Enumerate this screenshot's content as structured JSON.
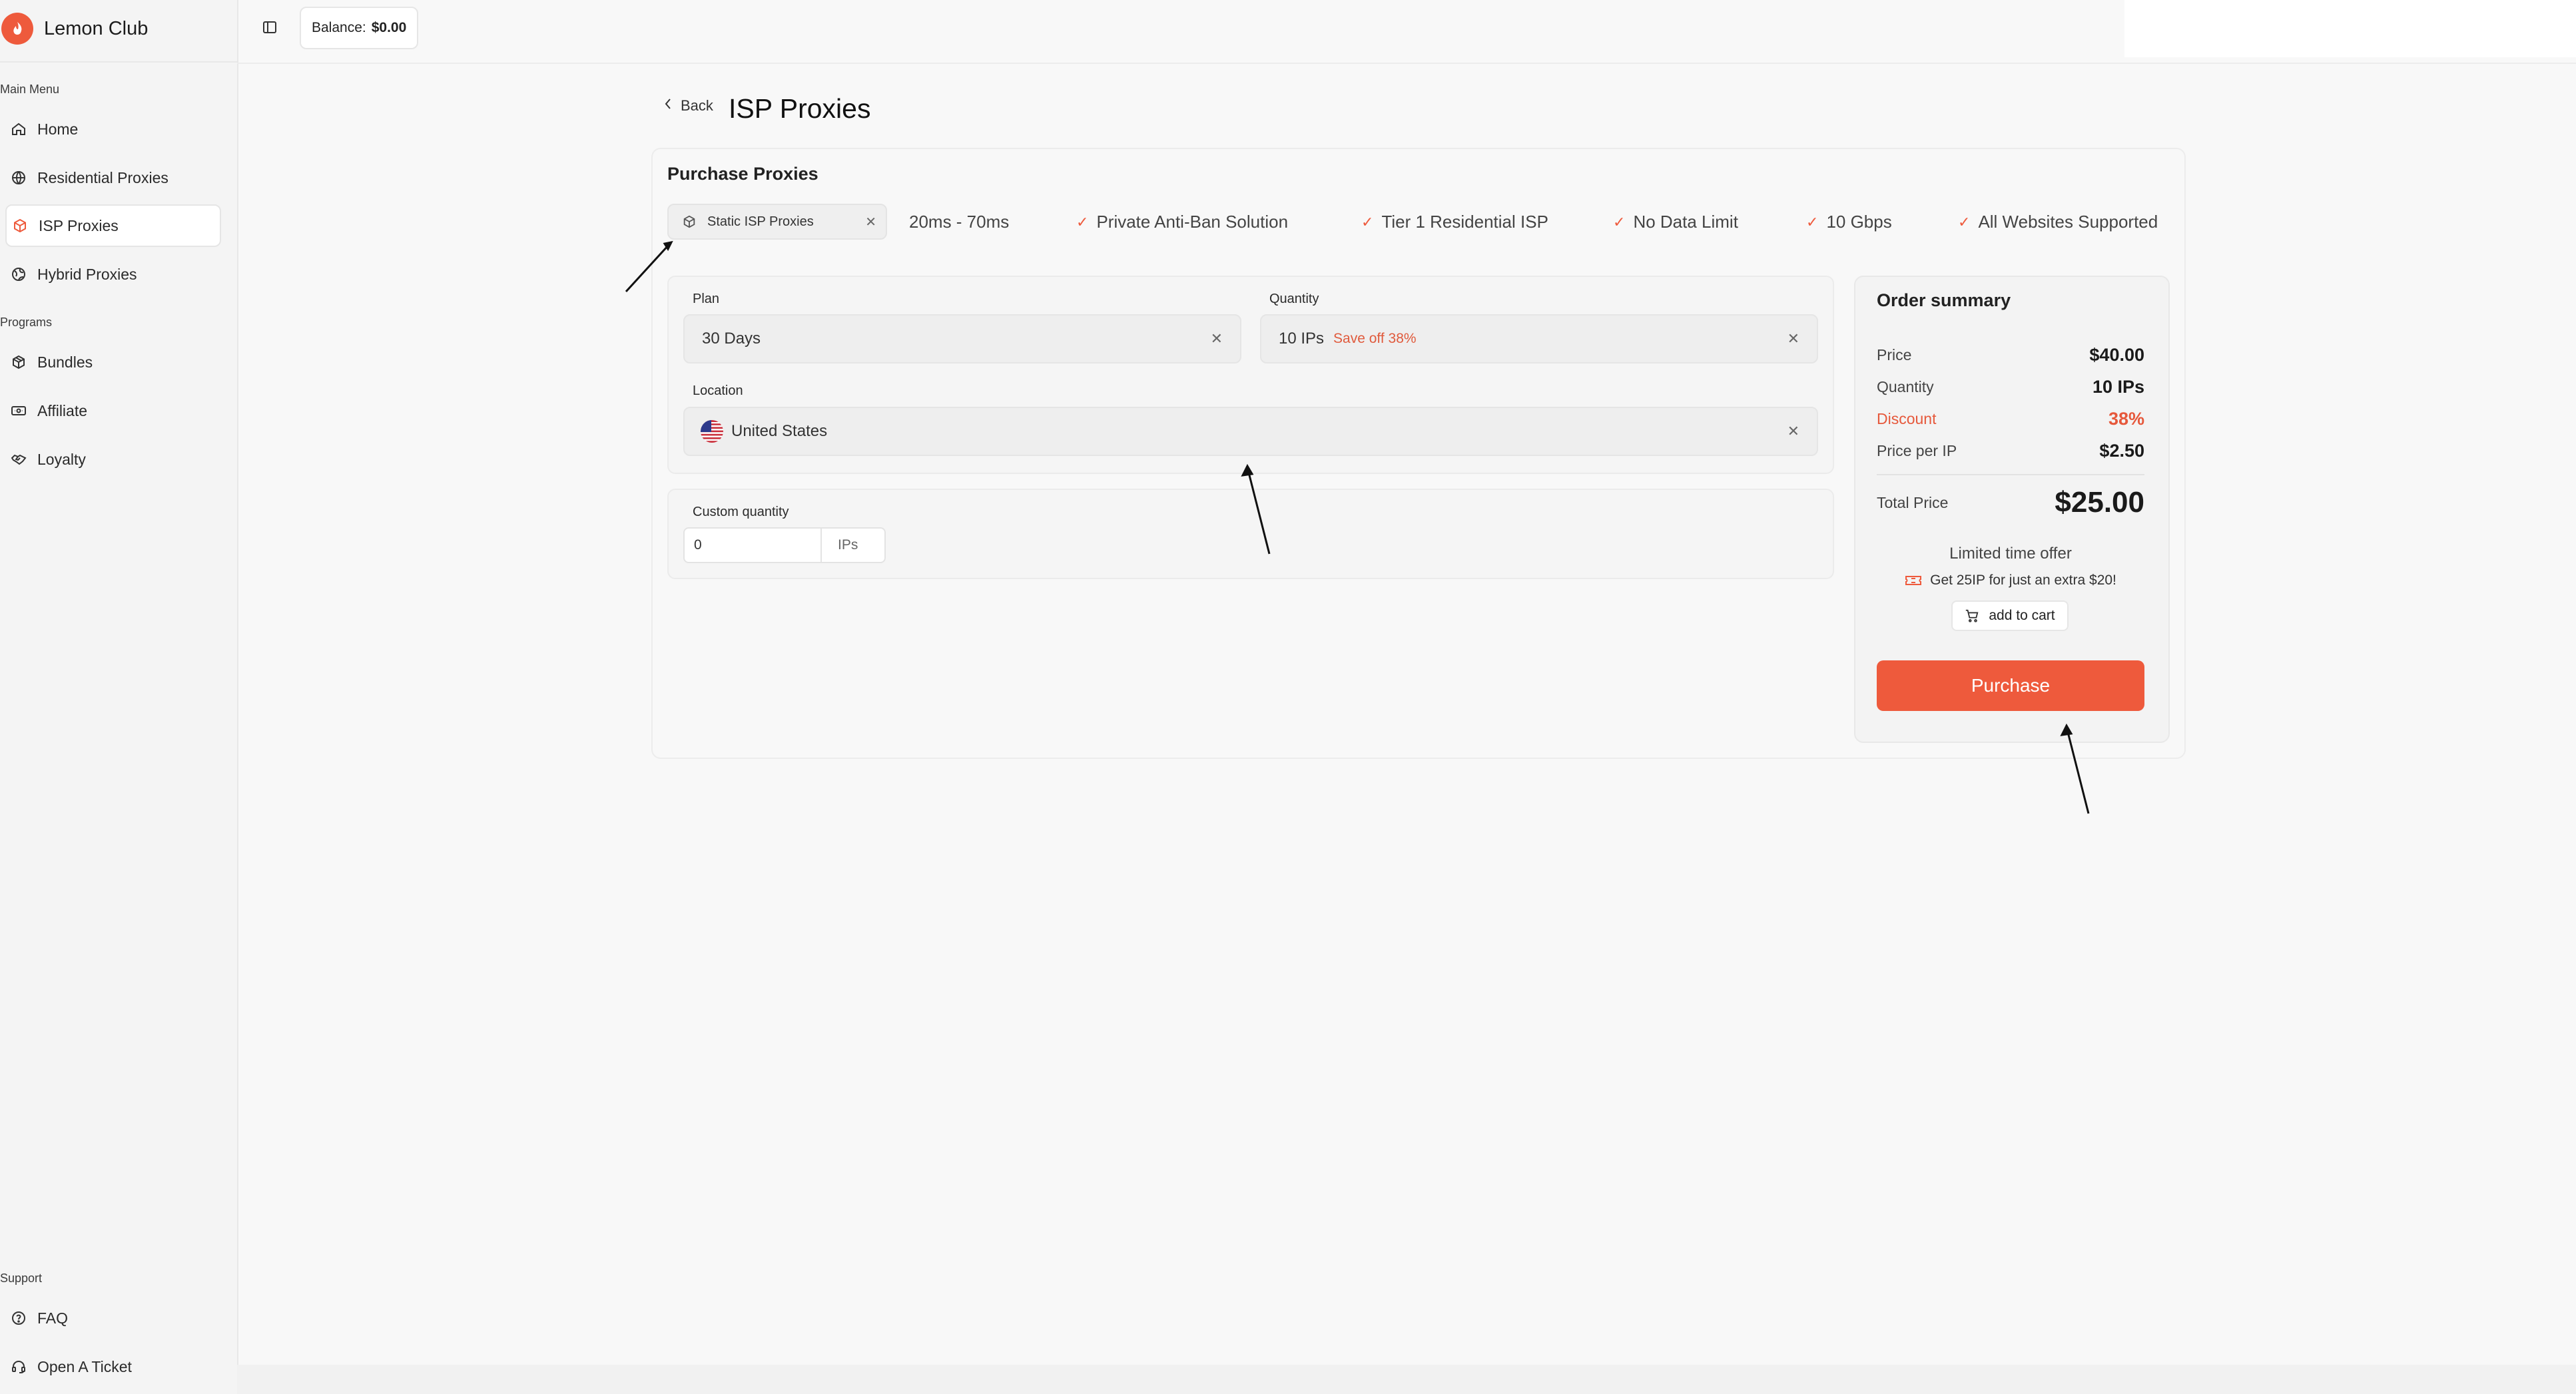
{
  "app": {
    "name": "Lemon Club"
  },
  "topbar": {
    "balance_label": "Balance:",
    "balance_value": "$0.00"
  },
  "sidebar": {
    "main_menu_label": "Main Menu",
    "main_items": [
      {
        "label": "Home",
        "icon": "home-icon"
      },
      {
        "label": "Residential Proxies",
        "icon": "globe-icon"
      },
      {
        "label": "ISP Proxies",
        "icon": "box-icon",
        "active": true
      },
      {
        "label": "Hybrid Proxies",
        "icon": "hybrid-globe-icon"
      }
    ],
    "programs_label": "Programs",
    "program_items": [
      {
        "label": "Bundles",
        "icon": "package-icon"
      },
      {
        "label": "Affiliate",
        "icon": "banknote-icon"
      },
      {
        "label": "Loyalty",
        "icon": "handshake-icon"
      }
    ],
    "support_label": "Support",
    "support_items": [
      {
        "label": "FAQ",
        "icon": "help-circle-icon"
      },
      {
        "label": "Open A Ticket",
        "icon": "headset-icon"
      }
    ]
  },
  "page": {
    "back_label": "Back",
    "title": "ISP Proxies"
  },
  "purchase": {
    "title": "Purchase Proxies",
    "product_chip": "Static ISP Proxies",
    "latency": "20ms - 70ms",
    "features": [
      "Private Anti-Ban Solution",
      "Tier 1 Residential ISP",
      "No Data Limit",
      "10 Gbps",
      "All Websites Supported"
    ],
    "plan": {
      "label": "Plan",
      "value": "30 Days"
    },
    "quantity": {
      "label": "Quantity",
      "value": "10 IPs",
      "badge": "Save off 38%"
    },
    "location": {
      "label": "Location",
      "value": "United States"
    },
    "custom_quantity": {
      "label": "Custom quantity",
      "value": "0",
      "unit": "IPs"
    }
  },
  "summary": {
    "title": "Order summary",
    "rows": [
      {
        "key": "Price",
        "value": "$40.00"
      },
      {
        "key": "Quantity",
        "value": "10 IPs"
      },
      {
        "key": "Discount",
        "value": "38%"
      },
      {
        "key": "Price per IP",
        "value": "$2.50"
      }
    ],
    "total_label": "Total Price",
    "total_value": "$25.00",
    "offer_title": "Limited time offer",
    "offer_text": "Get 25IP for just an extra $20!",
    "add_to_cart": "add to cart",
    "purchase_label": "Purchase"
  },
  "colors": {
    "accent": "#ee5a3c",
    "background": "#f8f8f8"
  }
}
